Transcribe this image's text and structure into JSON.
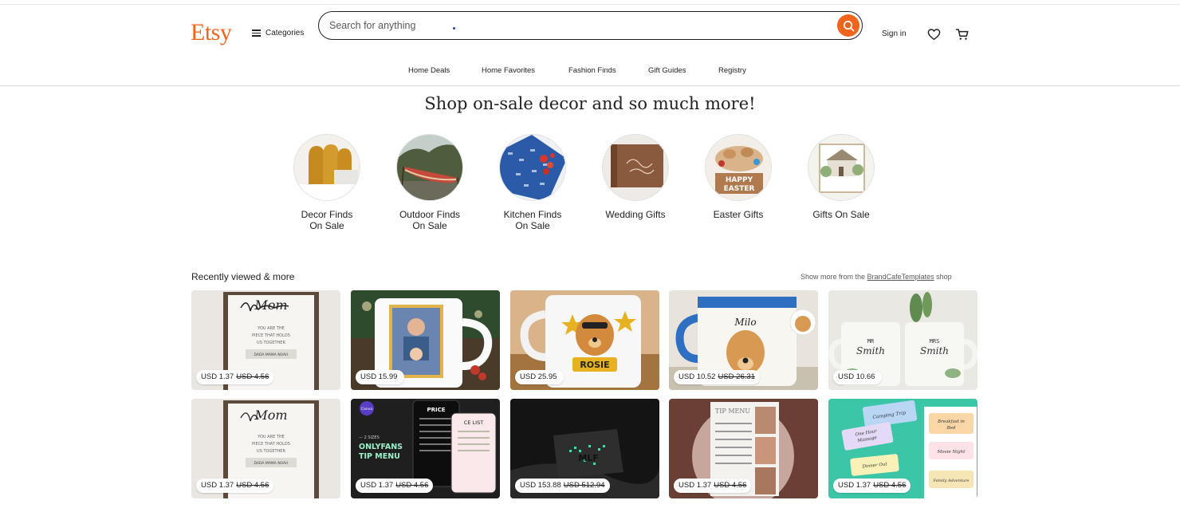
{
  "header": {
    "logo": "Etsy",
    "categories_label": "Categories",
    "search_placeholder": "Search for anything",
    "sign_in_label": "Sign in"
  },
  "nav": [
    {
      "label": "Home Deals"
    },
    {
      "label": "Home Favorites"
    },
    {
      "label": "Fashion Finds"
    },
    {
      "label": "Gift Guides"
    },
    {
      "label": "Registry"
    }
  ],
  "hero": {
    "title": "Shop on-sale decor and so much more!",
    "categories": [
      {
        "line1": "Decor Finds",
        "line2": "On Sale"
      },
      {
        "line1": "Outdoor Finds",
        "line2": "On Sale"
      },
      {
        "line1": "Kitchen Finds",
        "line2": "On Sale"
      },
      {
        "line1": "Wedding Gifts",
        "line2": ""
      },
      {
        "line1": "Easter Gifts",
        "line2": ""
      },
      {
        "line1": "Gifts On Sale",
        "line2": ""
      }
    ]
  },
  "recent": {
    "title": "Recently viewed & more",
    "show_more_prefix": "Show more from the",
    "shop_name": "BrandCafeTemplates",
    "show_more_suffix": "shop",
    "row1": [
      {
        "price": "USD 1.37",
        "old_price": "USD 4.56",
        "image_text": "Mom"
      },
      {
        "price": "USD 15.99",
        "old_price": "",
        "image_text": ""
      },
      {
        "price": "USD 25.95",
        "old_price": "",
        "image_text": "ROSIE"
      },
      {
        "price": "USD 10.52",
        "old_price": "USD 26.31",
        "image_text": "Milo"
      },
      {
        "price": "USD 10.66",
        "old_price": "",
        "image_text": "MR Smith · MRS Smith"
      }
    ],
    "row2": [
      {
        "price": "USD 1.37",
        "old_price": "USD 4.56",
        "image_text": "Mom"
      },
      {
        "price": "USD 1.37",
        "old_price": "USD 4.56",
        "image_text": "ONLYFANS TIP MENU"
      },
      {
        "price": "USD 153.88",
        "old_price": "USD 512.94",
        "image_text": "MLF"
      },
      {
        "price": "USD 1.37",
        "old_price": "USD 4.56",
        "image_text": "TIP MENU"
      },
      {
        "price": "USD 1.37",
        "old_price": "USD 4.56",
        "image_text": "Camping Trip"
      }
    ]
  },
  "colors": {
    "brand": "#f1641e",
    "text": "#222222"
  }
}
